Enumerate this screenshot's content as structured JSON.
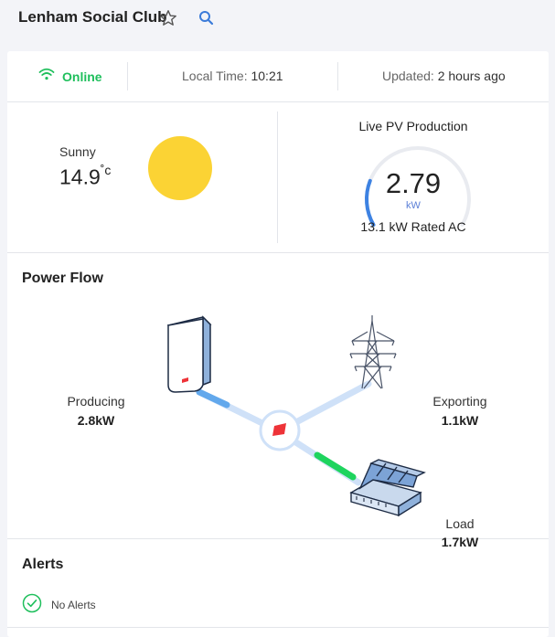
{
  "header": {
    "site_name": "Lenham Social Club",
    "favorite_icon": "star-outline-icon",
    "search_icon": "search-icon"
  },
  "status": {
    "online_label": "Online",
    "online_icon": "wifi-icon",
    "local_time_label": "Local Time:",
    "local_time_value": "10:21",
    "updated_label": "Updated:",
    "updated_value": "2 hours ago"
  },
  "weather": {
    "condition": "Sunny",
    "temperature": "14.9",
    "temperature_unit": "˚c",
    "icon": "sun-icon"
  },
  "pv": {
    "title": "Live PV Production",
    "value": "2.79",
    "unit": "kW",
    "rated": "13.1 kW Rated AC",
    "gauge_fraction": 0.213
  },
  "power_flow": {
    "title": "Power Flow",
    "producing_label": "Producing",
    "producing_value": "2.8kW",
    "exporting_label": "Exporting",
    "exporting_value": "1.1kW",
    "load_label": "Load",
    "load_value": "1.7kW",
    "colors": {
      "producing": "#62a8ec",
      "load": "#1ed45e",
      "line": "#cfe1f8"
    }
  },
  "alerts": {
    "title": "Alerts",
    "status_text": "No Alerts",
    "icon": "check-circle-icon"
  }
}
